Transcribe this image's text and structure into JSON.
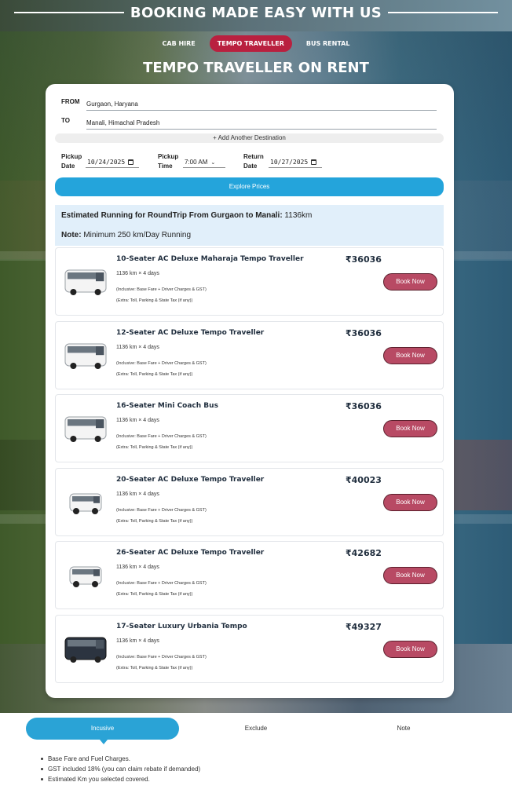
{
  "header": {
    "title": "BOOKING MADE EASY WITH US",
    "tabs": [
      {
        "label": "CAB HIRE",
        "active": false
      },
      {
        "label": "TEMPO TRAVELLER",
        "active": true
      },
      {
        "label": "BUS RENTAL",
        "active": false
      }
    ],
    "subtitle": "TEMPO TRAVELLER ON RENT"
  },
  "form": {
    "from_label": "FROM",
    "from_value": "Gurgaon, Haryana",
    "to_label": "TO",
    "to_value": "Manali, Himachal Pradesh",
    "add_destination": "+ Add Another Destination",
    "pickup_date_label": "Pickup Date",
    "pickup_date_value": "10/24/2025",
    "pickup_time_label": "Pickup Time",
    "pickup_time_value": "7:00 AM",
    "return_date_label": "Return Date",
    "return_date_value": "10/27/2025",
    "explore_button": "Explore Prices"
  },
  "estimate": {
    "line1_bold": "Estimated Running for RoundTrip From Gurgaon to Manali:",
    "line1_value": " 1136km",
    "line2_bold": "Note:",
    "line2_value": " Minimum 250 km/Day Running"
  },
  "vehicles": [
    {
      "name": "10-Seater AC Deluxe Maharaja Tempo Traveller",
      "price": "₹36036",
      "distance": "1136 km × 4 days",
      "inclusive": "(Inclusive: Base Fare + Driver Charges & GST)",
      "extra": "(Extra: Toll, Parking & State Tax (if any))",
      "button": "Book Now",
      "image": "tempo-traveller-white"
    },
    {
      "name": "12-Seater AC Deluxe Tempo Traveller",
      "price": "₹36036",
      "distance": "1136 km × 4 days",
      "inclusive": "(Inclusive: Base Fare + Driver Charges & GST)",
      "extra": "(Extra: Toll, Parking & State Tax (if any))",
      "button": "Book Now",
      "image": "tempo-traveller-white"
    },
    {
      "name": "16-Seater Mini Coach Bus",
      "price": "₹36036",
      "distance": "1136 km × 4 days",
      "inclusive": "(Inclusive: Base Fare + Driver Charges & GST)",
      "extra": "(Extra: Toll, Parking & State Tax (if any))",
      "button": "Book Now",
      "image": "tempo-traveller-white"
    },
    {
      "name": "20-Seater AC Deluxe Tempo Traveller",
      "price": "₹40023",
      "distance": "1136 km × 4 days",
      "inclusive": "(Inclusive: Base Fare + Driver Charges & GST)",
      "extra": "(Extra: Toll, Parking & State Tax (if any))",
      "button": "Book Now",
      "image": "tempo-traveller-white-small"
    },
    {
      "name": "26-Seater AC Deluxe Tempo Traveller",
      "price": "₹42682",
      "distance": "1136 km × 4 days",
      "inclusive": "(Inclusive: Base Fare + Driver Charges & GST)",
      "extra": "(Extra: Toll, Parking & State Tax (if any))",
      "button": "Book Now",
      "image": "tempo-traveller-white-small"
    },
    {
      "name": "17-Seater Luxury Urbania Tempo",
      "price": "₹49327",
      "distance": "1136 km × 4 days",
      "inclusive": "(Inclusive: Base Fare + Driver Charges & GST)",
      "extra": "(Extra: Toll, Parking & State Tax (if any))",
      "button": "Book Now",
      "image": "urbania-dark"
    }
  ],
  "bottom_tabs": [
    {
      "label": "Incusive",
      "active": true
    },
    {
      "label": "Exclude",
      "active": false
    },
    {
      "label": "Note",
      "active": false
    }
  ],
  "inclusions": [
    "Base Fare and Fuel Charges.",
    "GST included 18% (you can claim rebate if demanded)",
    "Estimated Km you selected covered."
  ],
  "colors": {
    "active_tab": "#b9203f",
    "explore_button": "#24a4db",
    "book_button": "#b84a64",
    "estimate_bg": "#e1effa",
    "bottom_tab_active": "#2aa3d6"
  }
}
